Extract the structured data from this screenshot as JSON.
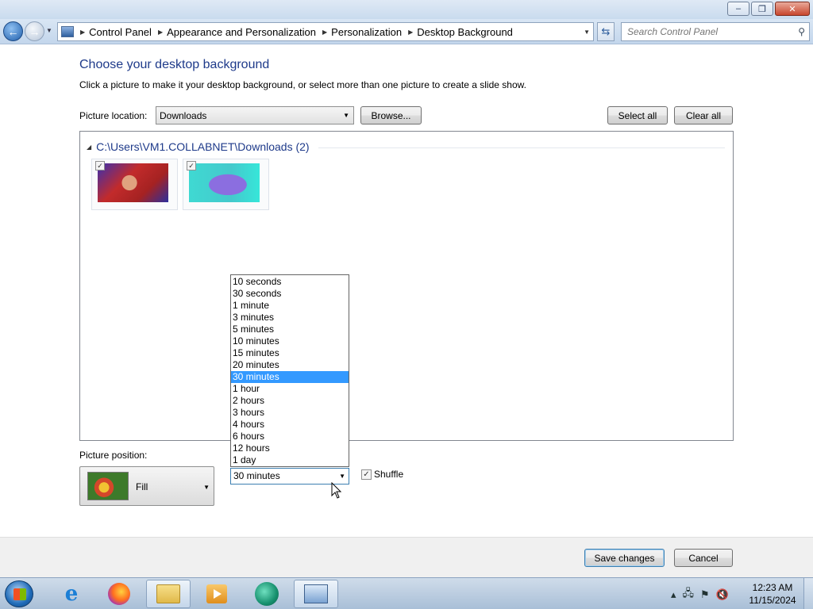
{
  "window": {
    "minimize_symbol": "–",
    "maximize_symbol": "❐",
    "close_symbol": "✕"
  },
  "nav": {
    "breadcrumbs": [
      "Control Panel",
      "Appearance and Personalization",
      "Personalization",
      "Desktop Background"
    ],
    "search_placeholder": "Search Control Panel"
  },
  "main": {
    "title": "Choose your desktop background",
    "description": "Click a picture to make it your desktop background, or select more than one picture to create a slide show.",
    "location_label": "Picture location:",
    "location_value": "Downloads",
    "browse_label": "Browse...",
    "select_all_label": "Select all",
    "clear_all_label": "Clear all",
    "group_title": "C:\\Users\\VM1.COLLABNET\\Downloads (2)",
    "thumbnails": [
      {
        "checked": true,
        "icon": "red-cartoon-image"
      },
      {
        "checked": true,
        "icon": "purple-cat-image"
      }
    ],
    "position_label": "Picture position:",
    "position_value": "Fill",
    "interval_options": [
      "10 seconds",
      "30 seconds",
      "1 minute",
      "3 minutes",
      "5 minutes",
      "10 minutes",
      "15 minutes",
      "20 minutes",
      "30 minutes",
      "1 hour",
      "2 hours",
      "3 hours",
      "4 hours",
      "6 hours",
      "12 hours",
      "1 day"
    ],
    "interval_selected": "30 minutes",
    "shuffle_label": "Shuffle",
    "shuffle_checked": true
  },
  "footer": {
    "save_label": "Save changes",
    "cancel_label": "Cancel"
  },
  "taskbar": {
    "time": "12:23 AM",
    "date": "11/15/2024"
  },
  "colors": {
    "title_text": "#1e3a8a",
    "selection": "#3399ff"
  }
}
